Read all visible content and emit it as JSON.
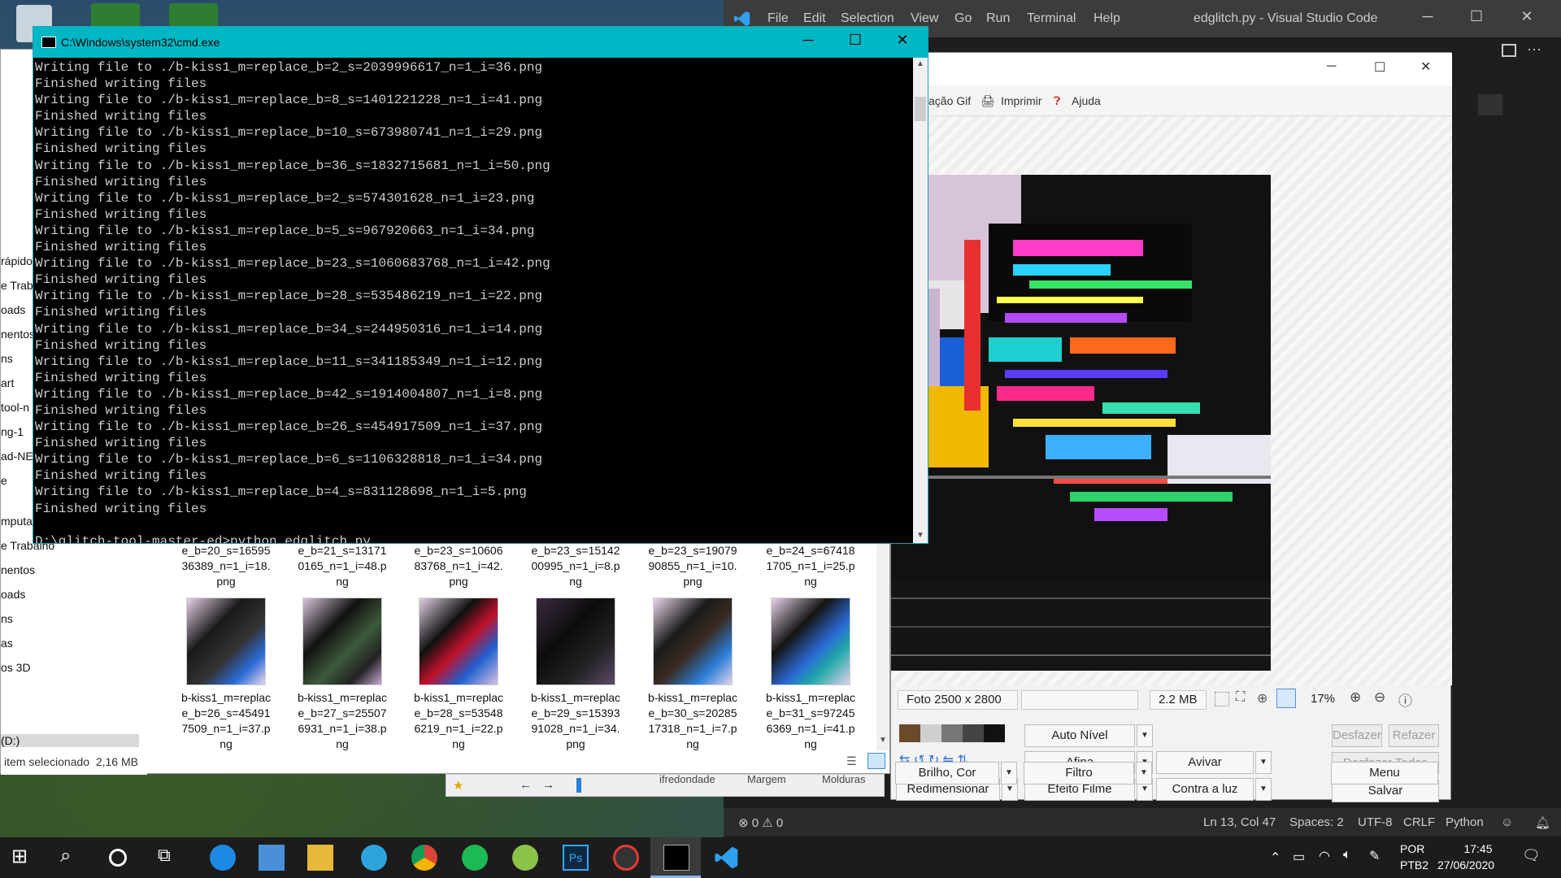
{
  "vscode": {
    "menu": [
      "File",
      "Edit",
      "Selection",
      "View",
      "Go",
      "Run",
      "Terminal",
      "Help"
    ],
    "title": "edglitch.py - Visual Studio Code",
    "status": {
      "problems": "⊗ 0 ⚠ 0",
      "position": "Ln 13, Col 47",
      "spaces": "Spaces: 2",
      "encoding": "UTF-8",
      "eol": "CRLF",
      "language": "Python"
    }
  },
  "cmd": {
    "title": "C:\\Windows\\system32\\cmd.exe",
    "lines": [
      "Writing file to ./b-kiss1_m=replace_b=2_s=2039996617_n=1_i=36.png",
      "Finished writing files",
      "Writing file to ./b-kiss1_m=replace_b=8_s=1401221228_n=1_i=41.png",
      "Finished writing files",
      "Writing file to ./b-kiss1_m=replace_b=10_s=673980741_n=1_i=29.png",
      "Finished writing files",
      "Writing file to ./b-kiss1_m=replace_b=36_s=1832715681_n=1_i=50.png",
      "Finished writing files",
      "Writing file to ./b-kiss1_m=replace_b=2_s=574301628_n=1_i=23.png",
      "Finished writing files",
      "Writing file to ./b-kiss1_m=replace_b=5_s=967920663_n=1_i=34.png",
      "Finished writing files",
      "Writing file to ./b-kiss1_m=replace_b=23_s=1060683768_n=1_i=42.png",
      "Finished writing files",
      "Writing file to ./b-kiss1_m=replace_b=28_s=535486219_n=1_i=22.png",
      "Finished writing files",
      "Writing file to ./b-kiss1_m=replace_b=34_s=244950316_n=1_i=14.png",
      "Finished writing files",
      "Writing file to ./b-kiss1_m=replace_b=11_s=341185349_n=1_i=12.png",
      "Finished writing files",
      "Writing file to ./b-kiss1_m=replace_b=42_s=1914004807_n=1_i=8.png",
      "Finished writing files",
      "Writing file to ./b-kiss1_m=replace_b=26_s=454917509_n=1_i=37.png",
      "Finished writing files",
      "Writing file to ./b-kiss1_m=replace_b=6_s=1106328818_n=1_i=34.png",
      "Finished writing files",
      "Writing file to ./b-kiss1_m=replace_b=4_s=831128698_n=1_i=5.png",
      "Finished writing files",
      "",
      "D:\\glitch-tool-master-ed>python edglitch.py"
    ]
  },
  "explorer": {
    "nav": [
      "rápido",
      "e Trab",
      "oads",
      "nentos",
      "ns",
      "art",
      "tool-n",
      "ng-1",
      "ad-NE",
      "e",
      "mputa",
      "e Trabalho",
      "nentos",
      "oads",
      "ns",
      "as",
      "os 3D",
      "",
      "",
      "(D:)"
    ],
    "status": "item selecionado  2,16 MB",
    "top_row": [
      {
        "name": "e_b=20_s=16595\n36389_n=1_i=18.\npng"
      },
      {
        "name": "e_b=21_s=13171\n0165_n=1_i=48.p\nng"
      },
      {
        "name": "e_b=23_s=10606\n83768_n=1_i=42.\npng"
      },
      {
        "name": "e_b=23_s=15142\n00995_n=1_i=8.p\nng"
      },
      {
        "name": "e_b=23_s=19079\n90855_n=1_i=10.\npng"
      },
      {
        "name": "e_b=24_s=67418\n1705_n=1_i=25.p\nng"
      }
    ],
    "bottom_row": [
      {
        "name": "b-kiss1_m=replac\ne_b=26_s=45491\n7509_n=1_i=37.p\nng"
      },
      {
        "name": "b-kiss1_m=replac\ne_b=27_s=25507\n6931_n=1_i=38.p\nng"
      },
      {
        "name": "b-kiss1_m=replac\ne_b=28_s=53548\n6219_n=1_i=22.p\nng"
      },
      {
        "name": "b-kiss1_m=replac\ne_b=29_s=15393\n91028_n=1_i=34.\npng"
      },
      {
        "name": "b-kiss1_m=replac\ne_b=30_s=20285\n17318_n=1_i=7.p\nng"
      },
      {
        "name": "b-kiss1_m=replac\ne_b=31_s=97245\n6369_n=1_i=41.p\nng"
      }
    ]
  },
  "photoeditor": {
    "toolbar": {
      "gif": "ação Gif",
      "print": "Imprimir",
      "help": "Ajuda"
    },
    "info": {
      "size": "Foto 2500 x 2800",
      "filesize": "2.2 MB",
      "zoom": "17%"
    },
    "buttons": {
      "auto_level": "Auto Nível",
      "sharpen": "Afina",
      "avivar": "Avivar",
      "resize": "Redimensionar",
      "film": "Efeito Filme",
      "backlight": "Contra a luz",
      "brightness": "Brilho, Cor",
      "filter": "Filtro",
      "undo": "Desfazer",
      "redo": "Refazer",
      "undo_all": "Desfazer Todos",
      "save": "Salvar",
      "menu": "Menu"
    },
    "bottom_tabs": [
      "ifredondade",
      "Margem",
      "Molduras"
    ]
  },
  "taskbar": {
    "lang_top": "POR",
    "lang_bottom": "PTB2",
    "time": "17:45",
    "date": "27/06/2020"
  }
}
